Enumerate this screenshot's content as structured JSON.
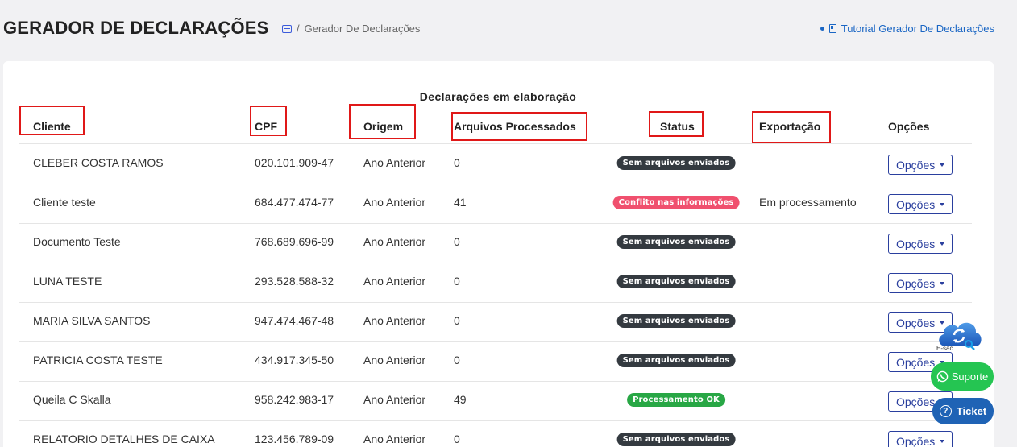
{
  "header": {
    "title": "GERADOR DE DECLARAÇÕES",
    "breadcrumb_separator": "/",
    "breadcrumb_current": "Gerador De Declarações",
    "breadcrumb_icon": "card-icon",
    "tutorial_label": "Tutorial Gerador De Declarações",
    "tutorial_icon": "book-icon"
  },
  "table": {
    "caption": "Declarações em elaboração",
    "columns": {
      "cliente": "Cliente",
      "cpf": "CPF",
      "origem": "Origem",
      "arquivos": "Arquivos Processados",
      "status": "Status",
      "exportacao": "Exportação",
      "opcoes": "Opções"
    },
    "rows": [
      {
        "cliente": "CLEBER COSTA RAMOS",
        "cpf": "020.101.909-47",
        "origem": "Ano Anterior",
        "arquivos": "0",
        "status": "Sem arquivos enviados",
        "status_color": "#343a40",
        "exportacao": "",
        "opcoes": "Opções"
      },
      {
        "cliente": "Cliente teste",
        "cpf": "684.477.474-77",
        "origem": "Ano Anterior",
        "arquivos": "41",
        "status": "Conflito nas informações",
        "status_color": "#f0506e",
        "exportacao": "Em processamento",
        "opcoes": "Opções"
      },
      {
        "cliente": "Documento Teste",
        "cpf": "768.689.696-99",
        "origem": "Ano Anterior",
        "arquivos": "0",
        "status": "Sem arquivos enviados",
        "status_color": "#343a40",
        "exportacao": "",
        "opcoes": "Opções"
      },
      {
        "cliente": "LUNA TESTE",
        "cpf": "293.528.588-32",
        "origem": "Ano Anterior",
        "arquivos": "0",
        "status": "Sem arquivos enviados",
        "status_color": "#343a40",
        "exportacao": "",
        "opcoes": "Opções"
      },
      {
        "cliente": "MARIA SILVA SANTOS",
        "cpf": "947.474.467-48",
        "origem": "Ano Anterior",
        "arquivos": "0",
        "status": "Sem arquivos enviados",
        "status_color": "#343a40",
        "exportacao": "",
        "opcoes": "Opções"
      },
      {
        "cliente": "PATRICIA COSTA TESTE",
        "cpf": "434.917.345-50",
        "origem": "Ano Anterior",
        "arquivos": "0",
        "status": "Sem arquivos enviados",
        "status_color": "#343a40",
        "exportacao": "",
        "opcoes": "Opções"
      },
      {
        "cliente": "Queila C Skalla",
        "cpf": "958.242.983-17",
        "origem": "Ano Anterior",
        "arquivos": "49",
        "status": "Processamento OK",
        "status_color": "#28a745",
        "exportacao": "",
        "opcoes": "Opções"
      },
      {
        "cliente": "RELATORIO DETALHES DE CAIXA",
        "cpf": "123.456.789-09",
        "origem": "Ano Anterior",
        "arquivos": "0",
        "status": "Sem arquivos enviados",
        "status_color": "#343a40",
        "exportacao": "",
        "opcoes": "Opções"
      }
    ]
  },
  "widgets": {
    "cloud_label": "E-sac",
    "cloud_icon": "cloud-sync-icon",
    "suporte_label": "Suporte",
    "suporte_icon": "whatsapp-icon",
    "ticket_label": "Ticket",
    "ticket_icon": "help-icon",
    "ticket_icon_glyph": "?"
  },
  "colors": {
    "highlight": "#e01818",
    "suporte_green": "#25c552",
    "ticket_blue": "#1f63b5",
    "link_blue": "#1a66c4"
  }
}
